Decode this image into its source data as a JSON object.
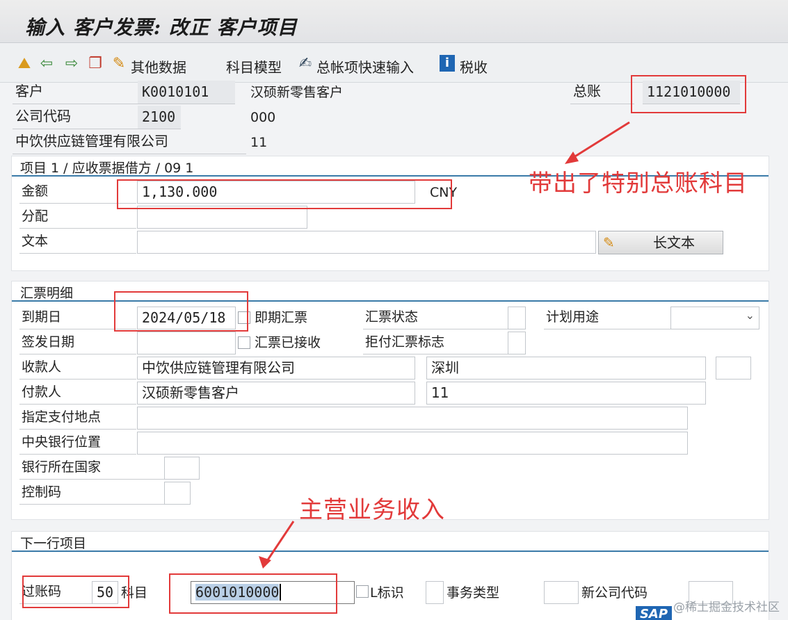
{
  "window": {
    "title": "输入 客户发票: 改正 客户项目"
  },
  "toolbar": {
    "other_data": "其他数据",
    "account_model": "科目模型",
    "gl_fast_entry": "总帐项快速输入",
    "tax": "税收"
  },
  "header": {
    "customer_label": "客户",
    "customer_value": "K0010101",
    "customer_name": "汉硕新零售客户",
    "gl_label": "总账",
    "gl_value": "1121010000",
    "company_code_label": "公司代码",
    "company_code_value": "2100",
    "code_000": "000",
    "company_name": "中饮供应链管理有限公司",
    "value_11": "11"
  },
  "item_panel": {
    "title": "项目 1 / 应收票据借方 / 09 1",
    "amount_label": "金额",
    "amount_value": "1,130.000",
    "currency": "CNY",
    "assignment_label": "分配",
    "assignment_value": "",
    "text_label": "文本",
    "text_value": "",
    "long_text_button": "长文本"
  },
  "bill_panel": {
    "title": "汇票明细",
    "due_date_label": "到期日",
    "due_date_value": "2024/05/18",
    "instant_bill_label": "即期汇票",
    "bill_status_label": "汇票状态",
    "plan_usage_label": "计划用途",
    "issue_date_label": "签发日期",
    "bill_accepted_label": "汇票已接收",
    "protest_flag_label": "拒付汇票标志",
    "payee_label": "收款人",
    "payee_value": "中饮供应链管理有限公司",
    "payee_city": "深圳",
    "payer_label": "付款人",
    "payer_value": "汉硕新零售客户",
    "payer_city": "11",
    "payment_place_label": "指定支付地点",
    "central_bank_label": "中央银行位置",
    "bank_country_label": "银行所在国家",
    "control_code_label": "控制码"
  },
  "next_item_panel": {
    "title": "下一行项目",
    "posting_key_label": "过账码",
    "posting_key_value": "50",
    "account_label": "科目",
    "account_value": "6001010000",
    "sgl_label": "L标识",
    "transaction_type_label": "事务类型",
    "new_company_code_label": "新公司代码"
  },
  "annotations": {
    "special_gl": "带出了特别总账科目",
    "main_revenue": "主营业务收入"
  },
  "colors": {
    "annotation": "#e23a3a",
    "accent_line": "#3a7aa8"
  },
  "watermark": "@稀土掘金技术社区",
  "sap_logo": "SAP"
}
